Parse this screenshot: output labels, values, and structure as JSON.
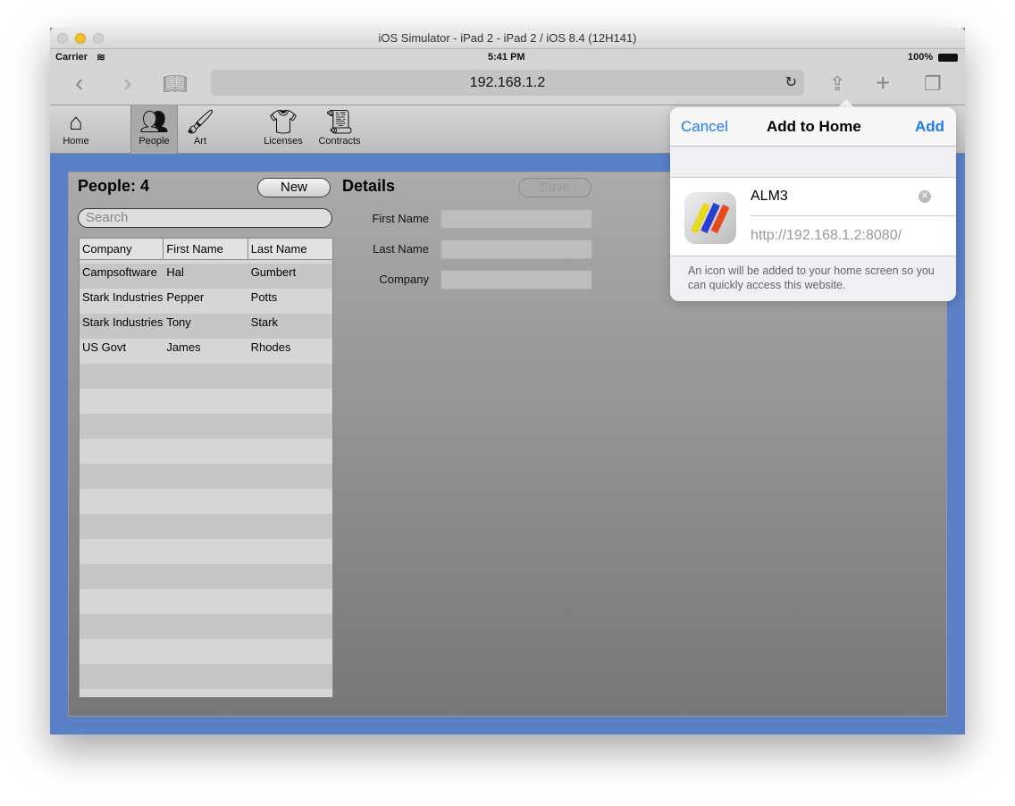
{
  "window": {
    "title": "iOS Simulator - iPad 2 - iPad 2 / iOS 8.4 (12H141)"
  },
  "status": {
    "carrier": "Carrier",
    "time": "5:41 PM",
    "battery": "100%"
  },
  "browser": {
    "url": "192.168.1.2"
  },
  "tabs": [
    {
      "label": "Home",
      "icon": "home-icon"
    },
    {
      "label": "People",
      "icon": "people-icon",
      "selected": true
    },
    {
      "label": "Art",
      "icon": "paintbrush-icon"
    },
    {
      "label": "Licenses",
      "icon": "shirt-icon"
    },
    {
      "label": "Contracts",
      "icon": "certificate-icon"
    }
  ],
  "people": {
    "title": "People: 4",
    "new_label": "New",
    "search_placeholder": "Search",
    "columns": [
      "Company",
      "First Name",
      "Last Name"
    ],
    "rows": [
      [
        "Campsoftware",
        "Hal",
        "Gumbert"
      ],
      [
        "Stark Industries",
        "Pepper",
        "Potts"
      ],
      [
        "Stark Industries",
        "Tony",
        "Stark"
      ],
      [
        "US Govt",
        "James",
        "Rhodes"
      ]
    ]
  },
  "details": {
    "title": "Details",
    "save_label": "Save",
    "fields": [
      "First Name",
      "Last Name",
      "Company"
    ]
  },
  "popover": {
    "cancel": "Cancel",
    "title": "Add to Home",
    "add": "Add",
    "name_value": "ALM3",
    "url": "http://192.168.1.2:8080/",
    "note": "An icon will be added to your home screen so you can quickly access this website."
  },
  "colors": {
    "accent": "#1a7cf0",
    "background": "#5a80c8"
  }
}
